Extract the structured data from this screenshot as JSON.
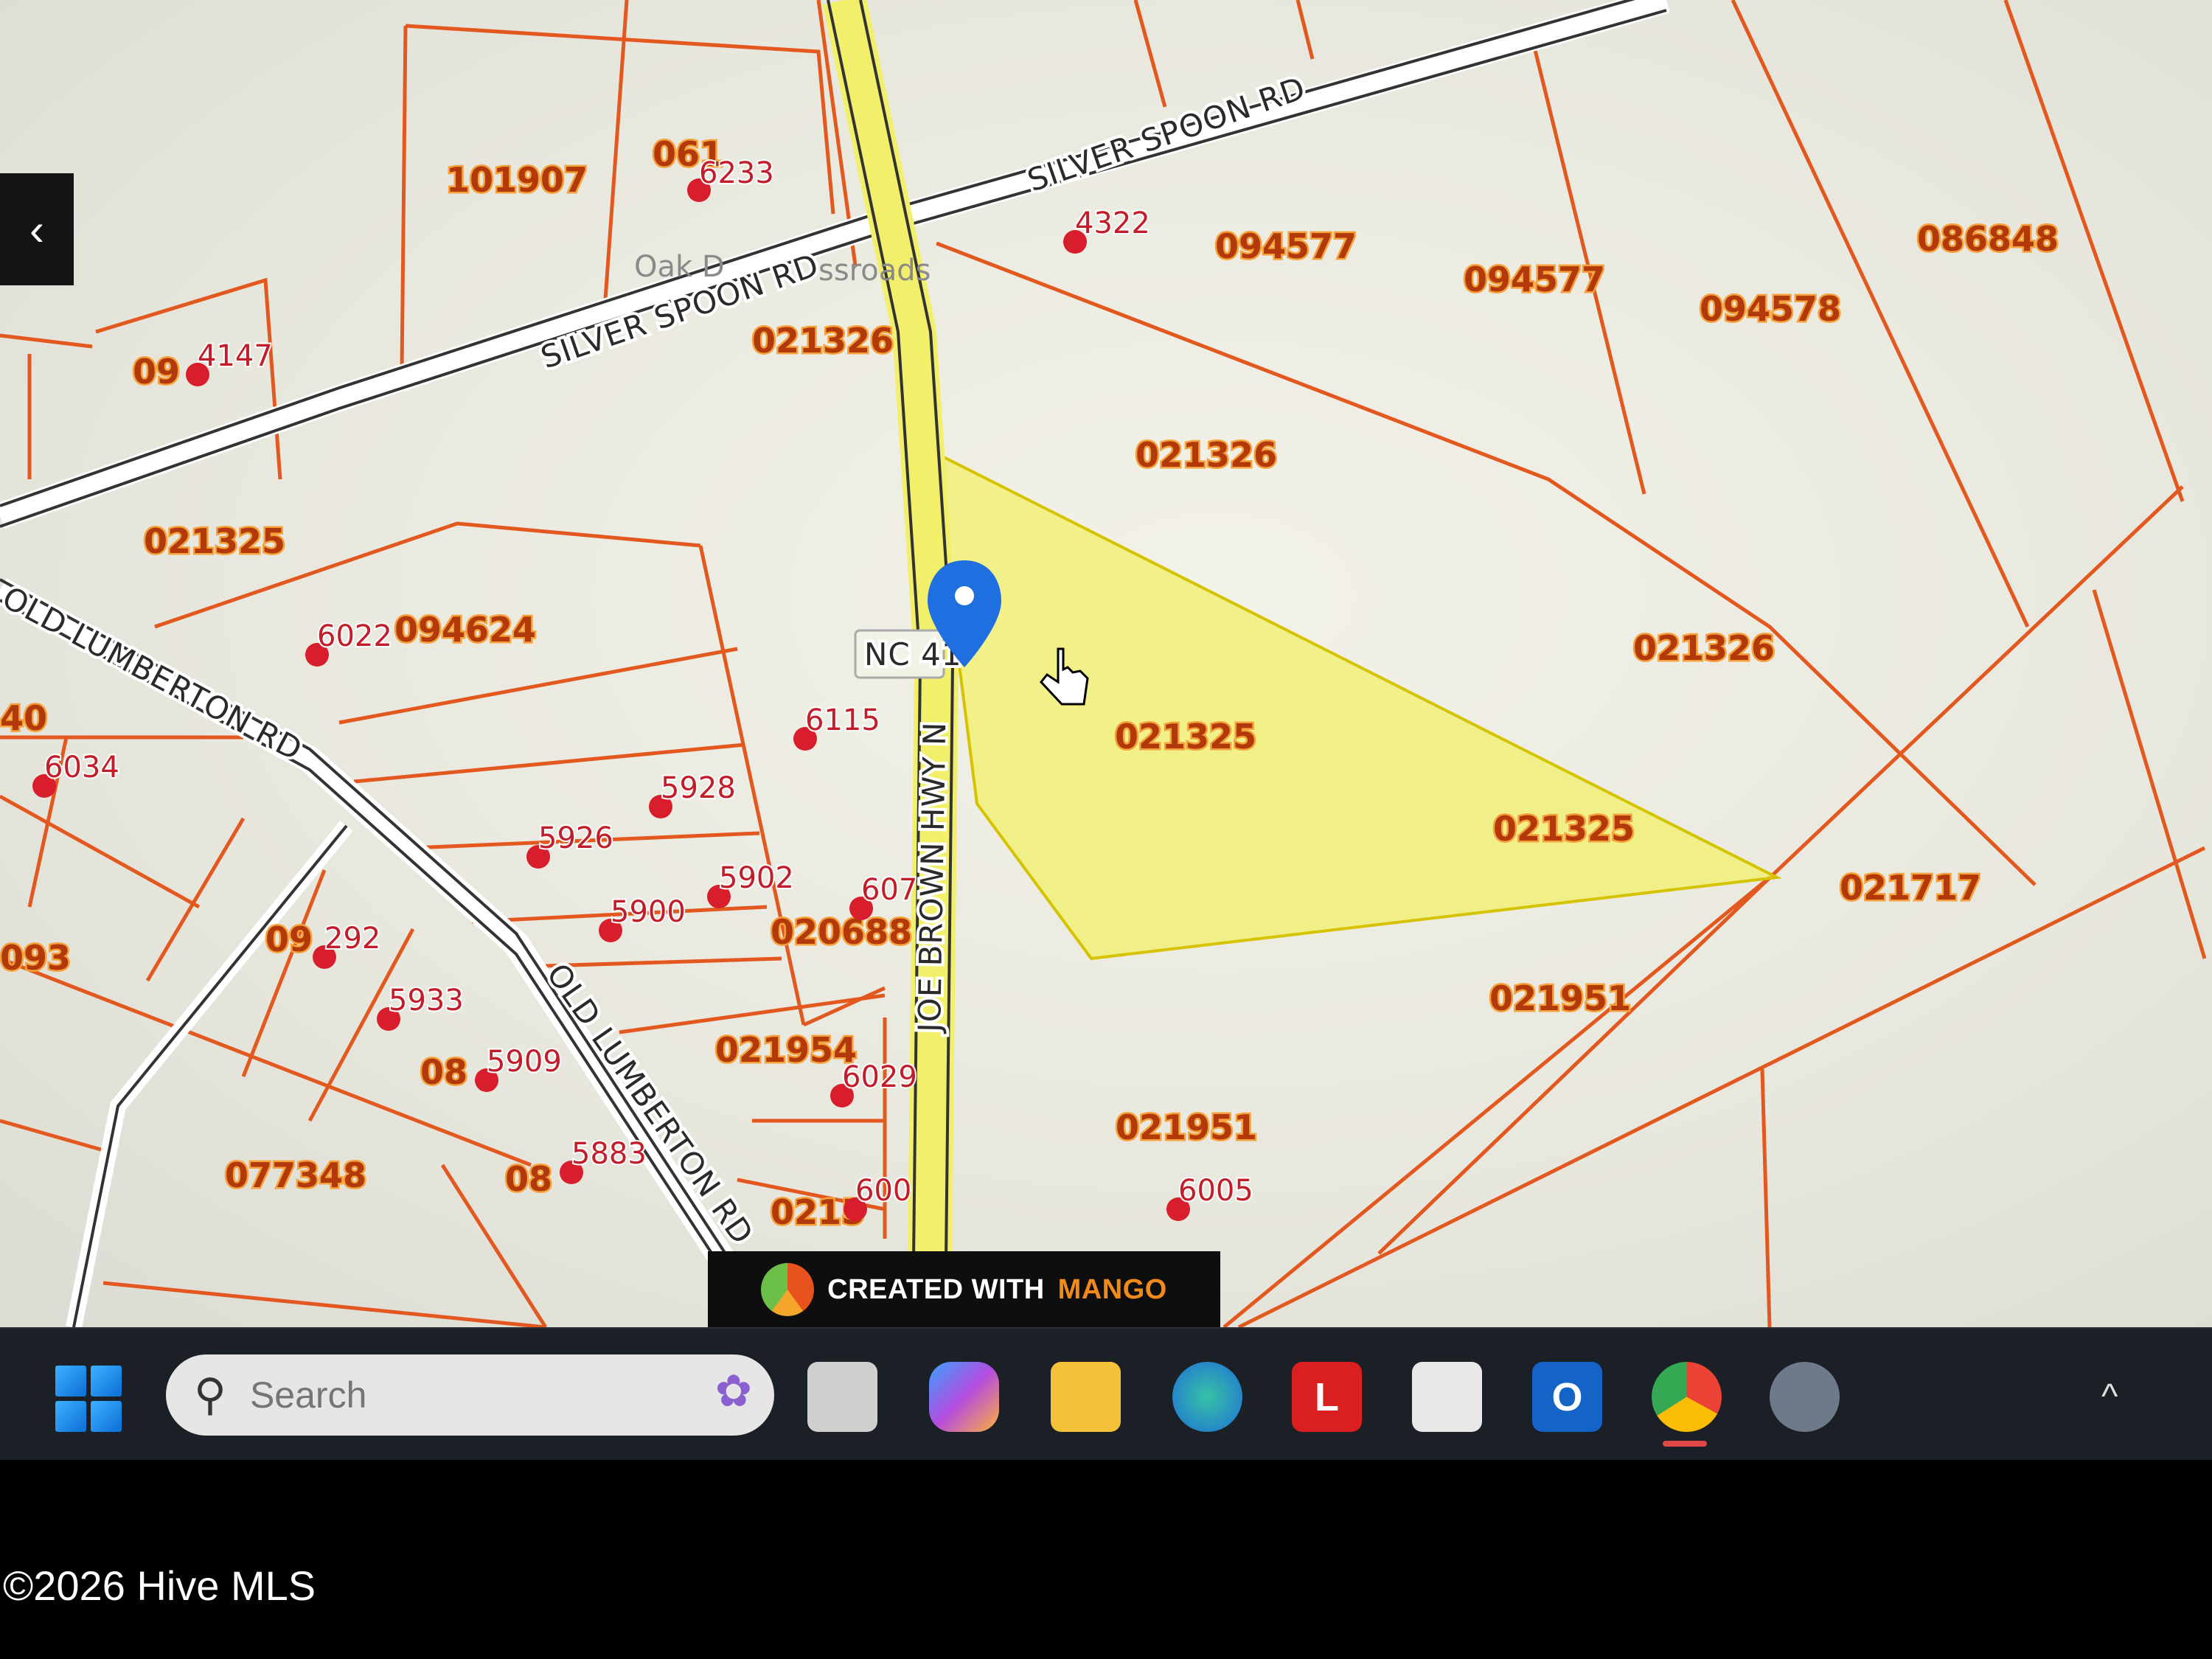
{
  "map": {
    "parcels": [
      "101907",
      "061",
      "021326",
      "094577",
      "094577",
      "086848",
      "094578",
      "09",
      "021325",
      "021326",
      "094624",
      "021326",
      "021325",
      "021325",
      "021717",
      "021951",
      "021951",
      "021954",
      "020688",
      "077348",
      "093",
      "09",
      "08",
      "08",
      "0215",
      "40"
    ],
    "addresses": [
      "6233",
      "4322",
      "4147",
      "6022",
      "6034",
      "6115",
      "5928",
      "5926",
      "5902",
      "5900",
      "607",
      "5933",
      "5909",
      "6029",
      "5883",
      "600",
      "6005",
      "292"
    ],
    "roads": [
      "SILVER SPOON RD",
      "SILVER SPOON RD",
      "OLD LUMBERTON RD",
      "OLD LUMBERTON RD",
      "JOE BROWN HWY N",
      "NC 41"
    ],
    "place": "Oak D",
    "place_suffix": "ssroads",
    "colors": {
      "parcel_line": "#e2581f",
      "highlight": "#f2f06a",
      "pin": "#1f6fe0"
    }
  },
  "back_button": {
    "label": "‹"
  },
  "badge": {
    "created_with": "CREATED WITH",
    "brand": "MANGO"
  },
  "taskbar": {
    "search_placeholder": "Search",
    "apps": [
      {
        "name": "task-view",
        "label": ""
      },
      {
        "name": "copilot",
        "label": ""
      },
      {
        "name": "file-explorer",
        "label": ""
      },
      {
        "name": "edge",
        "label": ""
      },
      {
        "name": "app-l",
        "label": "L"
      },
      {
        "name": "store",
        "label": ""
      },
      {
        "name": "outlook",
        "label": "O"
      },
      {
        "name": "chrome",
        "label": ""
      },
      {
        "name": "settings",
        "label": ""
      }
    ],
    "tray_chevron": "^"
  },
  "footer": {
    "copyright": "©2026 Hive MLS"
  }
}
